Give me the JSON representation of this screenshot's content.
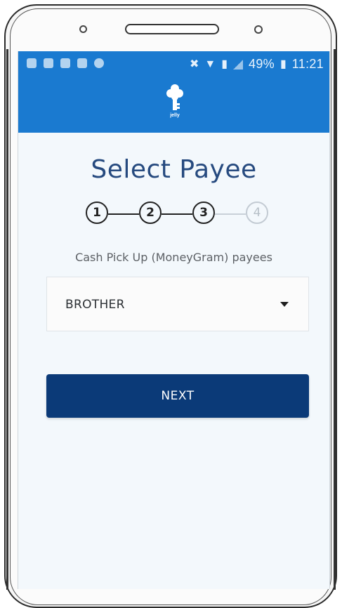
{
  "status_bar": {
    "battery": "49%",
    "time": "11:21",
    "icons": [
      "message-icon",
      "camera-icon",
      "gallery-icon",
      "sim-icon",
      "sync-icon",
      "mute-icon",
      "wifi-icon",
      "sim-icon",
      "signal-icon",
      "battery-icon"
    ]
  },
  "app": {
    "logo_text": "jelly",
    "brand_color": "#1a7ad0"
  },
  "page": {
    "title": "Select Payee"
  },
  "stepper": {
    "steps": [
      "1",
      "2",
      "3",
      "4"
    ],
    "current_step": 3
  },
  "payees": {
    "label": "Cash Pick Up (MoneyGram) payees",
    "selected": "BROTHER"
  },
  "actions": {
    "next_label": "NEXT",
    "next_color": "#0b3a78"
  }
}
